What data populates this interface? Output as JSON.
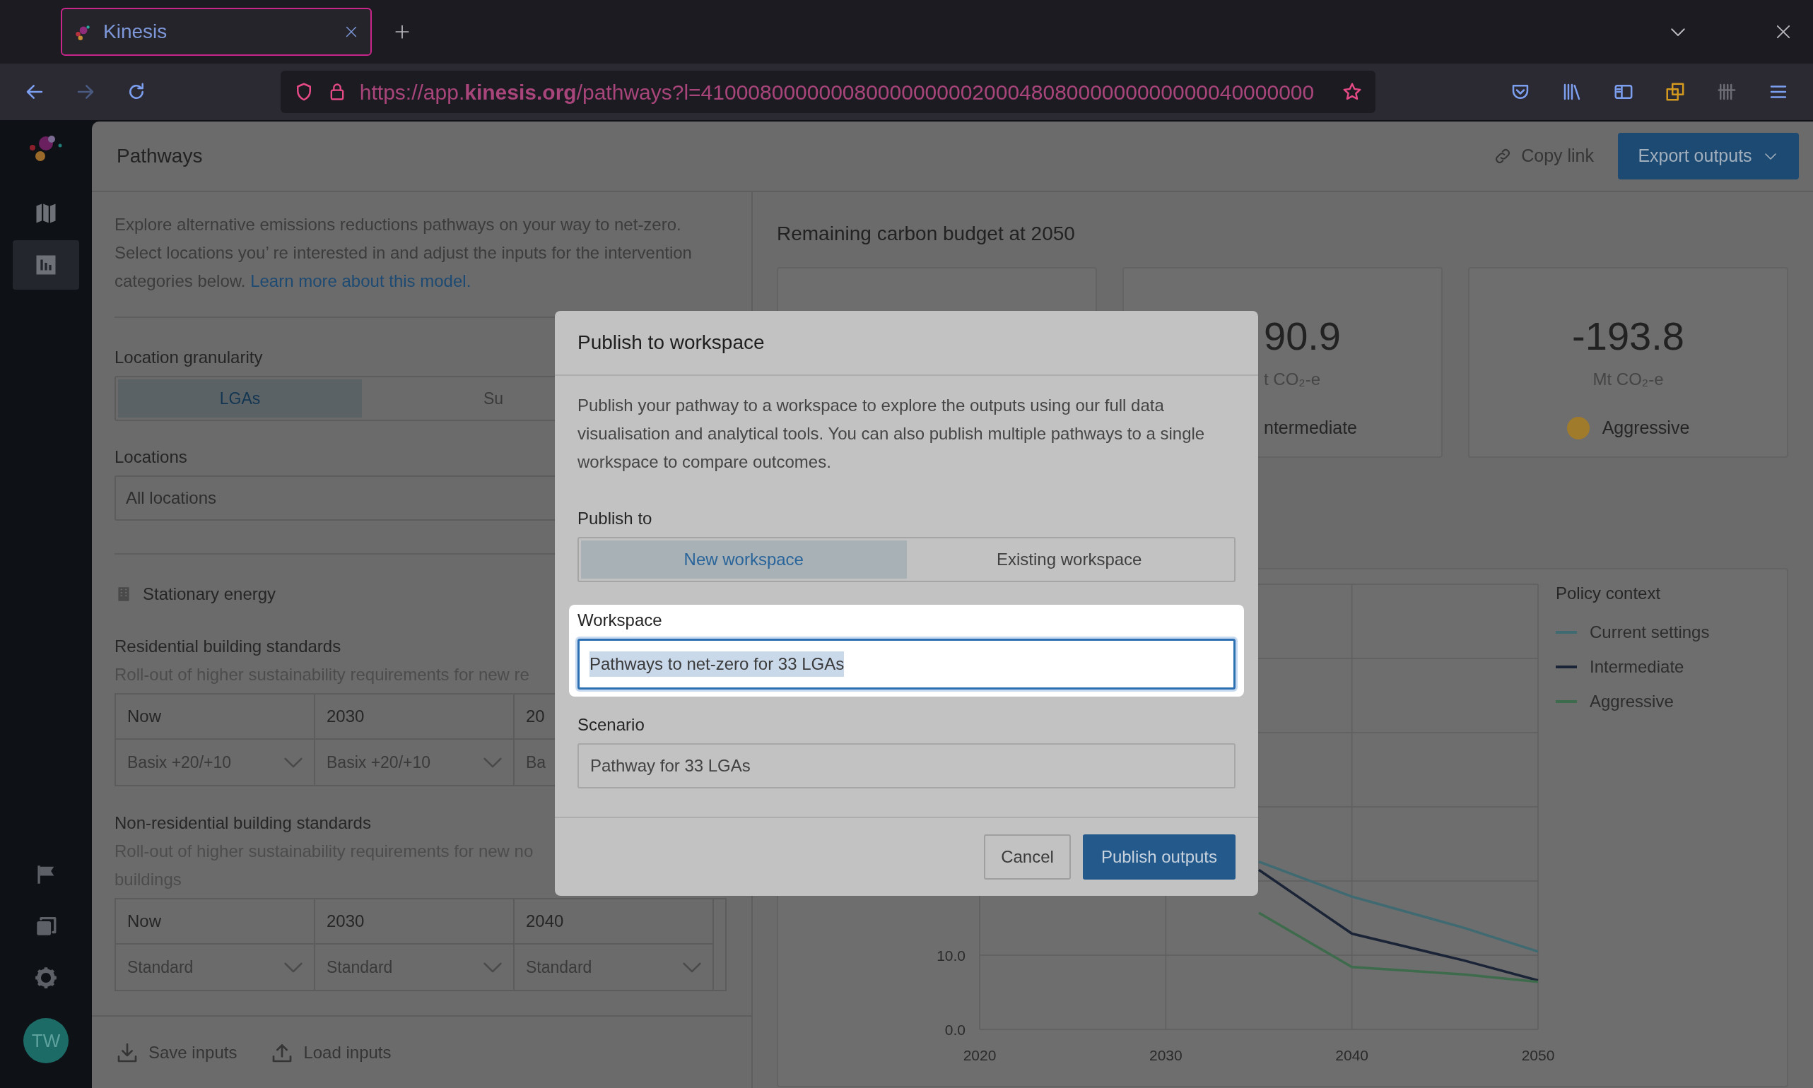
{
  "browser": {
    "tab_title": "Kinesis",
    "url": "https://app.**kinesis.org**/pathways?l=4100080000000800000000020004808000000000000040000000"
  },
  "sidebar": {
    "items": [
      {
        "selected": false
      },
      {
        "selected": true
      }
    ],
    "avatar": "TW"
  },
  "header": {
    "title": "Pathways",
    "copy_link": "Copy link",
    "export_button": "Export outputs"
  },
  "intro": {
    "text": "Explore alternative emissions reductions pathways on your way to net-zero. Select locations you’ re interested in and adjust the inputs for the intervention categories below.",
    "link": "Learn more about this model."
  },
  "location_granularity": {
    "label": "Location granularity",
    "options": [
      {
        "label": "LGAs",
        "selected": true
      },
      {
        "label": "Su",
        "selected": false
      }
    ]
  },
  "locations": {
    "label": "Locations",
    "value": "All locations"
  },
  "section_title": "Stationary energy",
  "standards": [
    {
      "title": "Residential building standards",
      "description_lines": [
        "Roll-out of higher sustainability requirements for new re"
      ],
      "columns": [
        "Now",
        "2030",
        "20"
      ],
      "values": [
        {
          "text": "Basix +20/+10",
          "chevron": true
        },
        {
          "text": "Basix +20/+10",
          "chevron": true
        },
        {
          "text": "Ba"
        }
      ]
    },
    {
      "title": "Non-residential building standards",
      "description_lines": [
        "Roll-out of higher sustainability requirements for new no",
        "buildings"
      ],
      "columns": [
        "Now",
        "2030",
        "2040"
      ],
      "values": [
        {
          "text": "Standard",
          "chevron": true
        },
        {
          "text": "Standard",
          "chevron": true
        },
        {
          "text": "Standard",
          "chevron": true
        }
      ]
    }
  ],
  "footer_buttons": [
    "Save inputs",
    "Load inputs"
  ],
  "budget": {
    "title": "Remaining carbon budget at 2050",
    "cards": [
      {
        "kind": "covered"
      },
      {
        "kind": "partial",
        "value": "90.9",
        "unit": "t CO₂-e",
        "label": "ntermediate"
      },
      {
        "kind": "full",
        "value": "-193.8",
        "unit": "Mt CO₂-e",
        "label": "Aggressive",
        "color": "#a17b2c"
      }
    ]
  },
  "chart": {
    "legend_title": "Policy context",
    "chart_data": {
      "type": "line",
      "grid": true,
      "x": [
        2035,
        2040,
        2046,
        2050
      ],
      "xlim": [
        2020,
        2050
      ],
      "ylim": [
        0,
        60
      ],
      "xticks": [
        2020,
        2030,
        2040,
        2050
      ],
      "yticks": [
        {
          "value": 0,
          "label": "0.0"
        },
        {
          "value": 10,
          "label": "10.0"
        }
      ],
      "series": [
        {
          "name": "Current settings",
          "color": "#3f6a72",
          "values": [
            22.6,
            17.9,
            13.7,
            10.5
          ]
        },
        {
          "name": "Intermediate",
          "color": "#1a2436",
          "values": [
            21.5,
            12.9,
            9.3,
            6.6
          ]
        },
        {
          "name": "Aggressive",
          "color": "#3d6b4c",
          "values": [
            15.7,
            8.4,
            7.4,
            6.4
          ]
        }
      ]
    }
  },
  "modal": {
    "title": "Publish to workspace",
    "description": "Publish your pathway to a workspace to explore the outputs using our full data visualisation and analytical tools. You can also publish multiple pathways to a single workspace to compare outcomes.",
    "publish_to": {
      "label": "Publish to",
      "options": [
        {
          "label": "New workspace",
          "selected": true
        },
        {
          "label": "Existing workspace",
          "selected": false
        }
      ]
    },
    "workspace": {
      "label": "Workspace",
      "value": "Pathways to net-zero for 33 LGAs"
    },
    "scenario": {
      "label": "Scenario",
      "value": "Pathway for 33 LGAs"
    },
    "buttons": [
      {
        "label": "Cancel",
        "kind": "secondary"
      },
      {
        "label": "Publish outputs",
        "kind": "primary"
      }
    ]
  }
}
